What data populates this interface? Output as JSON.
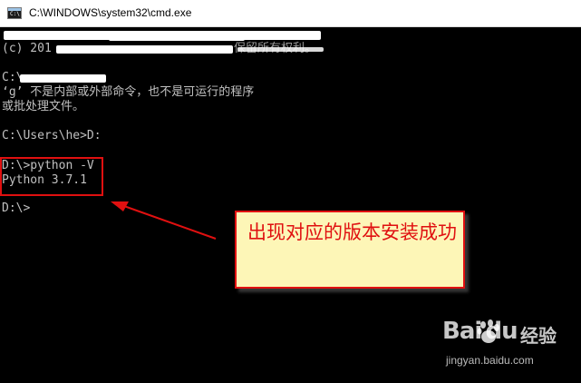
{
  "window": {
    "title": "C:\\WINDOWS\\system32\\cmd.exe",
    "icon": "cmd-icon"
  },
  "console": {
    "lines": [
      "‘g’ 不是内部或外部命令，也不是可运行的程序",
      "或批处理文件。",
      "C:\\Users\\he>D:",
      "D:\\>python -V",
      "Python 3.7.1",
      "D:\\>"
    ],
    "partial": {
      "copyright_prefix": "(c) 201",
      "copyright_suffix": "保留所有权利。",
      "path_prefix": "C:\\"
    }
  },
  "annotation": {
    "callout_text": "出现对应的版本安装成功",
    "color": "#e01010",
    "callout_bg": "#fdf6b7"
  },
  "watermark": {
    "logo_text": "Bai du",
    "logo_suffix": "经验",
    "url": "jingyan.baidu.com"
  }
}
